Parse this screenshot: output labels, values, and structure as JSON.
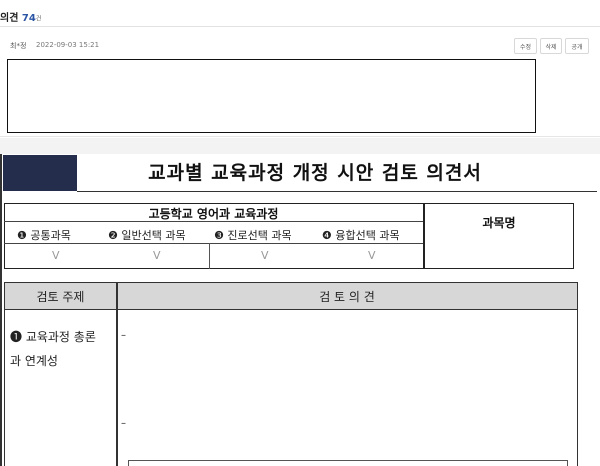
{
  "header": {
    "title": "의견",
    "count": "74",
    "unit": "건"
  },
  "comment": {
    "author": "최*정",
    "date": "2022-09-03 15:21",
    "buttons": {
      "edit": "수정",
      "delete": "삭제",
      "public": "공개"
    },
    "text": ""
  },
  "document": {
    "title": "교과별 교육과정 개정 시안 검토 의견서",
    "course_table": {
      "heading": "고등학교 영어과 교육과정",
      "subject_header": "과목명",
      "types": [
        {
          "num": "❶",
          "label": "공통과목",
          "checked_mark": "V"
        },
        {
          "num": "❷",
          "label": "일반선택 과목",
          "checked_mark": "V"
        },
        {
          "num": "❸",
          "label": "진로선택 과목",
          "checked_mark": "V"
        },
        {
          "num": "❹",
          "label": "융합선택 과목",
          "checked_mark": "V"
        }
      ]
    },
    "review_table": {
      "col1": "검토 주제",
      "col2": "검 토 의 견",
      "topic_line1": "❶ 교육과정 총론",
      "topic_line2": "과 연계성",
      "bullets": [
        "–",
        "–"
      ]
    }
  }
}
